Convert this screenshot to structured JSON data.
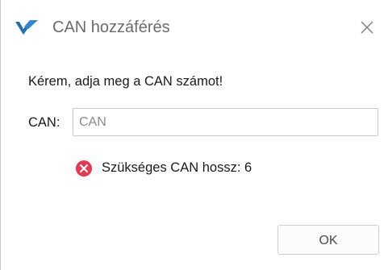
{
  "window": {
    "title": "CAN hozzáférés",
    "icon": "check-logo-icon",
    "close_icon": "close-icon"
  },
  "form": {
    "prompt": "Kérem, adja meg a CAN számot!",
    "can_label": "CAN:",
    "can_input": {
      "value": "",
      "placeholder": "CAN"
    },
    "error": {
      "icon": "error-icon",
      "message": "Szükséges CAN hossz: 6"
    }
  },
  "buttons": {
    "ok_label": "OK"
  },
  "colors": {
    "accent": "#1d6fb8",
    "error": "#e8384f",
    "border": "#c7c7c7",
    "title_text": "#6b6b6b"
  }
}
